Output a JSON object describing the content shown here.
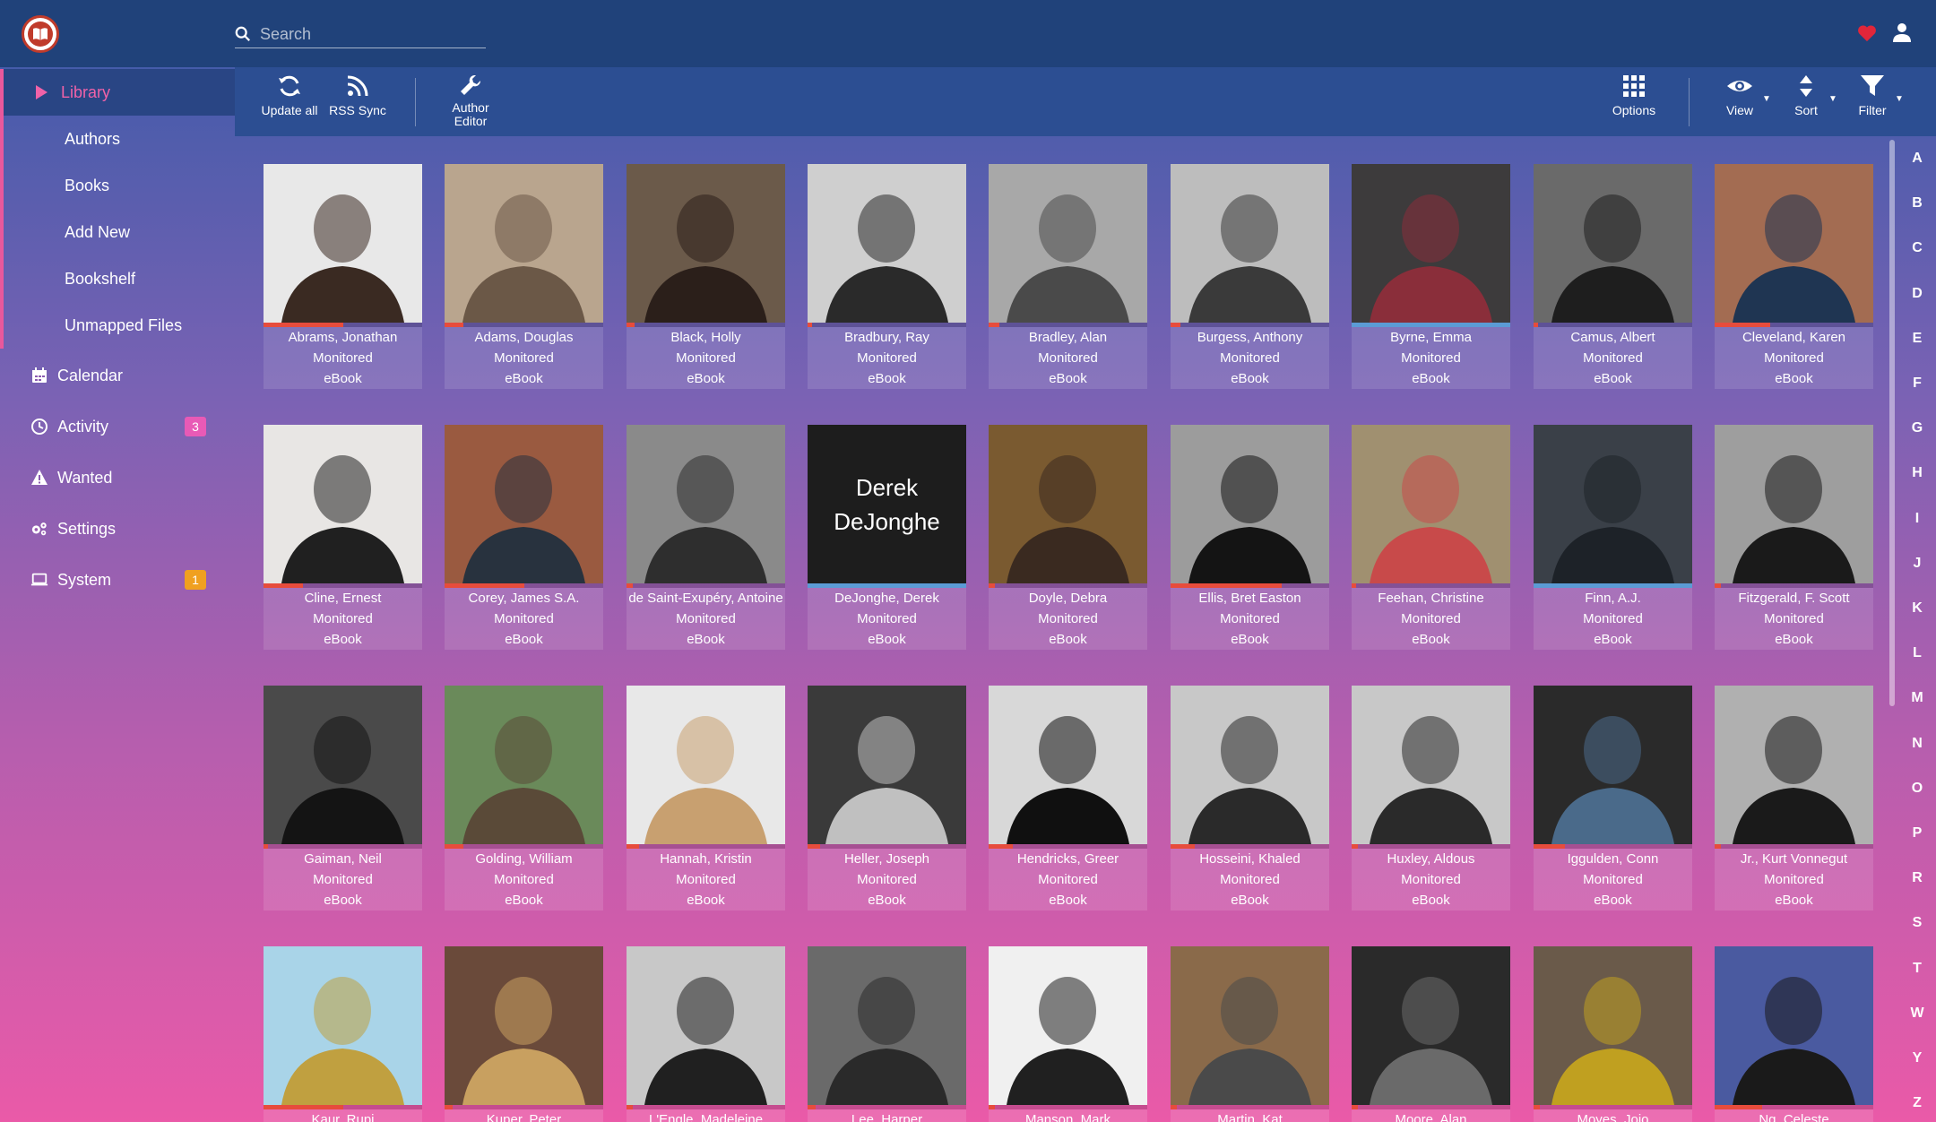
{
  "header": {
    "search_placeholder": "Search",
    "heart_color": "#e0263a"
  },
  "sidebar": {
    "items": [
      {
        "label": "Library",
        "icon": "play-icon",
        "active": true
      },
      {
        "label": "Authors",
        "sub": true
      },
      {
        "label": "Books",
        "sub": true
      },
      {
        "label": "Add New",
        "sub": true
      },
      {
        "label": "Bookshelf",
        "sub": true
      },
      {
        "label": "Unmapped Files",
        "sub": true
      },
      {
        "label": "Calendar",
        "icon": "calendar-icon"
      },
      {
        "label": "Activity",
        "icon": "clock-icon",
        "badge": "3",
        "badge_color": "#e85ab6"
      },
      {
        "label": "Wanted",
        "icon": "warning-icon"
      },
      {
        "label": "Settings",
        "icon": "gears-icon"
      },
      {
        "label": "System",
        "icon": "laptop-icon",
        "badge": "1",
        "badge_color": "#f0a020"
      }
    ]
  },
  "toolbar": {
    "update_all": "Update all",
    "rss_sync": "RSS Sync",
    "author_editor_1": "Author",
    "author_editor_2": "Editor",
    "options": "Options",
    "view": "View",
    "sort": "Sort",
    "filter": "Filter"
  },
  "authors": [
    {
      "name": "Abrams, Jonathan",
      "status": "Monitored",
      "type": "eBook",
      "progress": 0.5,
      "bar": "#e74c3c"
    },
    {
      "name": "Adams, Douglas",
      "status": "Monitored",
      "type": "eBook",
      "progress": 0.12,
      "bar": "#e74c3c"
    },
    {
      "name": "Black, Holly",
      "status": "Monitored",
      "type": "eBook",
      "progress": 0.05,
      "bar": "#e74c3c"
    },
    {
      "name": "Bradbury, Ray",
      "status": "Monitored",
      "type": "eBook",
      "progress": 0.03,
      "bar": "#e74c3c"
    },
    {
      "name": "Bradley, Alan",
      "status": "Monitored",
      "type": "eBook",
      "progress": 0.07,
      "bar": "#e74c3c"
    },
    {
      "name": "Burgess, Anthony",
      "status": "Monitored",
      "type": "eBook",
      "progress": 0.06,
      "bar": "#e74c3c"
    },
    {
      "name": "Byrne, Emma",
      "status": "Monitored",
      "type": "eBook",
      "progress": 1.0,
      "bar": "#5b9bd5"
    },
    {
      "name": "Camus, Albert",
      "status": "Monitored",
      "type": "eBook",
      "progress": 0.03,
      "bar": "#e74c3c"
    },
    {
      "name": "Cleveland, Karen",
      "status": "Monitored",
      "type": "eBook",
      "progress": 0.35,
      "bar": "#e74c3c"
    },
    {
      "name": "Cline, Ernest",
      "status": "Monitored",
      "type": "eBook",
      "progress": 0.25,
      "bar": "#e74c3c"
    },
    {
      "name": "Corey, James S.A.",
      "status": "Monitored",
      "type": "eBook",
      "progress": 0.5,
      "bar": "#e74c3c"
    },
    {
      "name": "de Saint-Exupéry, Antoine",
      "status": "Monitored",
      "type": "eBook",
      "progress": 0.04,
      "bar": "#e74c3c"
    },
    {
      "name": "DeJonghe, Derek",
      "status": "Monitored",
      "type": "eBook",
      "progress": 1.0,
      "bar": "#5b9bd5",
      "text_poster": "Derek DeJonghe"
    },
    {
      "name": "Doyle, Debra",
      "status": "Monitored",
      "type": "eBook",
      "progress": 0.04,
      "bar": "#e74c3c"
    },
    {
      "name": "Ellis, Bret Easton",
      "status": "Monitored",
      "type": "eBook",
      "progress": 0.7,
      "bar": "#e74c3c"
    },
    {
      "name": "Feehan, Christine",
      "status": "Monitored",
      "type": "eBook",
      "progress": 0.03,
      "bar": "#e74c3c"
    },
    {
      "name": "Finn, A.J.",
      "status": "Monitored",
      "type": "eBook",
      "progress": 1.0,
      "bar": "#5b9bd5"
    },
    {
      "name": "Fitzgerald, F. Scott",
      "status": "Monitored",
      "type": "eBook",
      "progress": 0.04,
      "bar": "#e74c3c"
    },
    {
      "name": "Gaiman, Neil",
      "status": "Monitored",
      "type": "eBook",
      "progress": 0.03,
      "bar": "#e74c3c"
    },
    {
      "name": "Golding, William",
      "status": "Monitored",
      "type": "eBook",
      "progress": 0.12,
      "bar": "#e74c3c"
    },
    {
      "name": "Hannah, Kristin",
      "status": "Monitored",
      "type": "eBook",
      "progress": 0.08,
      "bar": "#e74c3c"
    },
    {
      "name": "Heller, Joseph",
      "status": "Monitored",
      "type": "eBook",
      "progress": 0.08,
      "bar": "#e74c3c"
    },
    {
      "name": "Hendricks, Greer",
      "status": "Monitored",
      "type": "eBook",
      "progress": 0.15,
      "bar": "#e74c3c"
    },
    {
      "name": "Hosseini, Khaled",
      "status": "Monitored",
      "type": "eBook",
      "progress": 0.15,
      "bar": "#e74c3c"
    },
    {
      "name": "Huxley, Aldous",
      "status": "Monitored",
      "type": "eBook",
      "progress": 0.04,
      "bar": "#e74c3c"
    },
    {
      "name": "Iggulden, Conn",
      "status": "Monitored",
      "type": "eBook",
      "progress": 0.2,
      "bar": "#e74c3c"
    },
    {
      "name": "Jr., Kurt Vonnegut",
      "status": "Monitored",
      "type": "eBook",
      "progress": 0.04,
      "bar": "#e74c3c"
    },
    {
      "name": "Kaur, Rupi",
      "status": "",
      "type": "",
      "progress": 0.5,
      "bar": "#e74c3c"
    },
    {
      "name": "Kuper, Peter",
      "status": "",
      "type": "",
      "progress": 0.05,
      "bar": "#e74c3c"
    },
    {
      "name": "L'Engle, Madeleine",
      "status": "",
      "type": "",
      "progress": 0.04,
      "bar": "#e74c3c"
    },
    {
      "name": "Lee, Harper",
      "status": "",
      "type": "",
      "progress": 0.05,
      "bar": "#e74c3c"
    },
    {
      "name": "Manson, Mark",
      "status": "",
      "type": "",
      "progress": 0.04,
      "bar": "#e74c3c"
    },
    {
      "name": "Martin, Kat",
      "status": "",
      "type": "",
      "progress": 0.04,
      "bar": "#e74c3c"
    },
    {
      "name": "Moore, Alan",
      "status": "",
      "type": "",
      "progress": 0.04,
      "bar": "#e74c3c"
    },
    {
      "name": "Moyes, Jojo",
      "status": "",
      "type": "",
      "progress": 0.04,
      "bar": "#e74c3c"
    },
    {
      "name": "Ng, Celeste",
      "status": "",
      "type": "",
      "progress": 0.3,
      "bar": "#e74c3c"
    }
  ],
  "jump_letters": [
    "A",
    "B",
    "C",
    "D",
    "E",
    "F",
    "G",
    "H",
    "I",
    "J",
    "K",
    "L",
    "M",
    "N",
    "O",
    "P",
    "R",
    "S",
    "T",
    "W",
    "Y",
    "Z"
  ]
}
